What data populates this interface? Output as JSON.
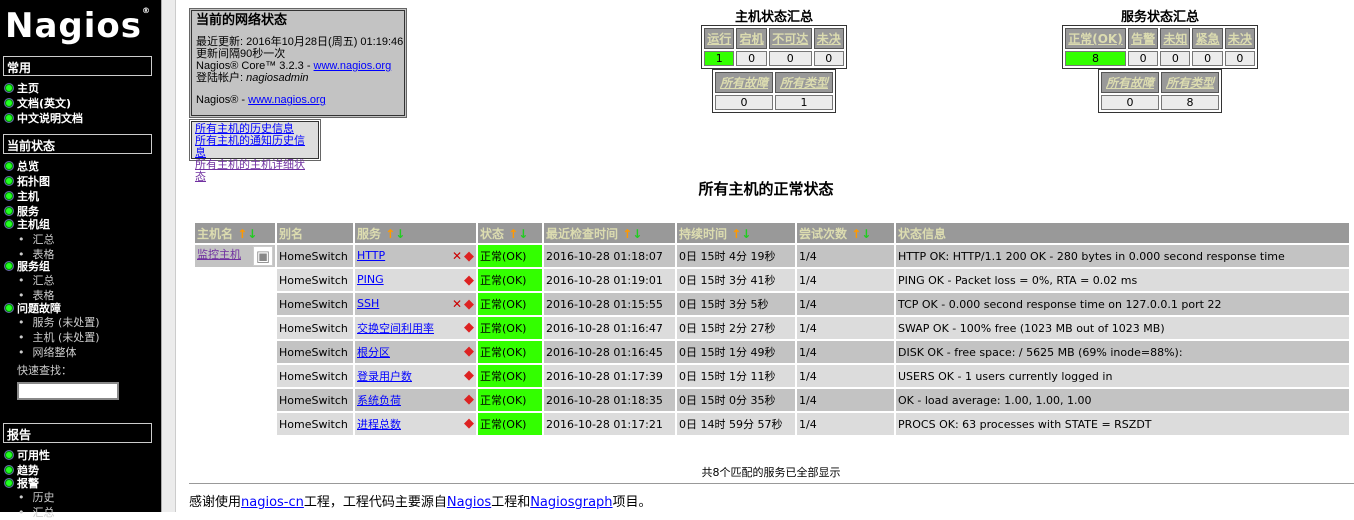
{
  "sidebar": {
    "logo": "Nagios",
    "sections": [
      {
        "title": "常用"
      },
      {
        "title": "当前状态"
      },
      {
        "title": "报告"
      }
    ],
    "common": [
      "主页",
      "文档(英文)",
      "中文说明文档"
    ],
    "status": [
      "总览",
      "拓扑图",
      "主机",
      "服务",
      "主机组",
      "服务组",
      "问题故障"
    ],
    "hostgroup_sub": [
      "汇总",
      "表格"
    ],
    "servicegroup_sub": [
      "汇总",
      "表格"
    ],
    "problems_sub": [
      "服务 (未处置)",
      "主机 (未处置)",
      "网络整体"
    ],
    "quick_search": "快速查找：",
    "reports": [
      "可用性",
      "趋势",
      "报警"
    ],
    "alerts_sub": [
      "历史",
      "汇总"
    ]
  },
  "info": {
    "title": "当前的网络状态",
    "updated": "最近更新: 2016年10月28日(周五) 01:19:46",
    "interval": "更新间隔90秒一次",
    "core": "Nagios® Core™ 3.2.3 - ",
    "core_link": "www.nagios.org",
    "login_label": "登陆帐户: ",
    "login_user": "nagiosadmin",
    "nagios": "Nagios® - ",
    "nagios_link": "www.nagios.org"
  },
  "links": [
    "所有主机的历史信息",
    "所有主机的通知历史信息",
    "所有主机的主机详细状态"
  ],
  "host_summary": {
    "title": "主机状态汇总",
    "headers": [
      "运行",
      "宕机",
      "不可达",
      "未决"
    ],
    "values": [
      "1",
      "0",
      "0",
      "0"
    ],
    "totals_headers": [
      "所有故障",
      "所有类型"
    ],
    "totals": [
      "0",
      "1"
    ]
  },
  "service_summary": {
    "title": "服务状态汇总",
    "headers": [
      "正常(OK)",
      "告警",
      "未知",
      "紧急",
      "未决"
    ],
    "values": [
      "8",
      "0",
      "0",
      "0",
      "0"
    ],
    "totals_headers": [
      "所有故障",
      "所有类型"
    ],
    "totals": [
      "0",
      "8"
    ]
  },
  "page_title": "所有主机的正常状态",
  "table": {
    "headers": [
      "主机名",
      "别名",
      "服务",
      "状态",
      "最近检查时间",
      "持续时间",
      "尝试次数",
      "状态信息"
    ],
    "host": "监控主机",
    "rows": [
      [
        "HomeSwitch",
        "HTTP",
        "正常(OK)",
        "2016-10-28 01:18:07",
        "0日 15时 4分 19秒",
        "1/4",
        "HTTP OK: HTTP/1.1 200 OK - 280 bytes in 0.000 second response time"
      ],
      [
        "HomeSwitch",
        "PING",
        "正常(OK)",
        "2016-10-28 01:19:01",
        "0日 15时 3分 41秒",
        "1/4",
        "PING OK - Packet loss = 0%, RTA = 0.02 ms"
      ],
      [
        "HomeSwitch",
        "SSH",
        "正常(OK)",
        "2016-10-28 01:15:55",
        "0日 15时 3分 5秒",
        "1/4",
        "TCP OK - 0.000 second response time on 127.0.0.1 port 22"
      ],
      [
        "HomeSwitch",
        "交换空间利用率",
        "正常(OK)",
        "2016-10-28 01:16:47",
        "0日 15时 2分 27秒",
        "1/4",
        "SWAP OK - 100% free (1023 MB out of 1023 MB)"
      ],
      [
        "HomeSwitch",
        "根分区",
        "正常(OK)",
        "2016-10-28 01:16:45",
        "0日 15时 1分 49秒",
        "1/4",
        "DISK OK - free space: / 5625 MB (69% inode=88%):"
      ],
      [
        "HomeSwitch",
        "登录用户数",
        "正常(OK)",
        "2016-10-28 01:17:39",
        "0日 15时 1分 11秒",
        "1/4",
        "USERS OK - 1 users currently logged in"
      ],
      [
        "HomeSwitch",
        "系统负荷",
        "正常(OK)",
        "2016-10-28 01:18:35",
        "0日 15时 0分 35秒",
        "1/4",
        "OK - load average: 1.00, 1.00, 1.00"
      ],
      [
        "HomeSwitch",
        "进程总数",
        "正常(OK)",
        "2016-10-28 01:17:21",
        "0日 14时 59分 57秒",
        "1/4",
        "PROCS OK: 63 processes with STATE = RSZDT"
      ]
    ],
    "muted": [
      true,
      false,
      true,
      false,
      false,
      false,
      false,
      false
    ]
  },
  "count": "共8个匹配的服务已全部显示",
  "footer": {
    "a": "感谢使用",
    "l1": "nagios-cn",
    "b": "工程，工程代码主要源自",
    "l2": "Nagios",
    "c": "工程和",
    "l3": "Nagiosgraph",
    "d": "项目。"
  }
}
